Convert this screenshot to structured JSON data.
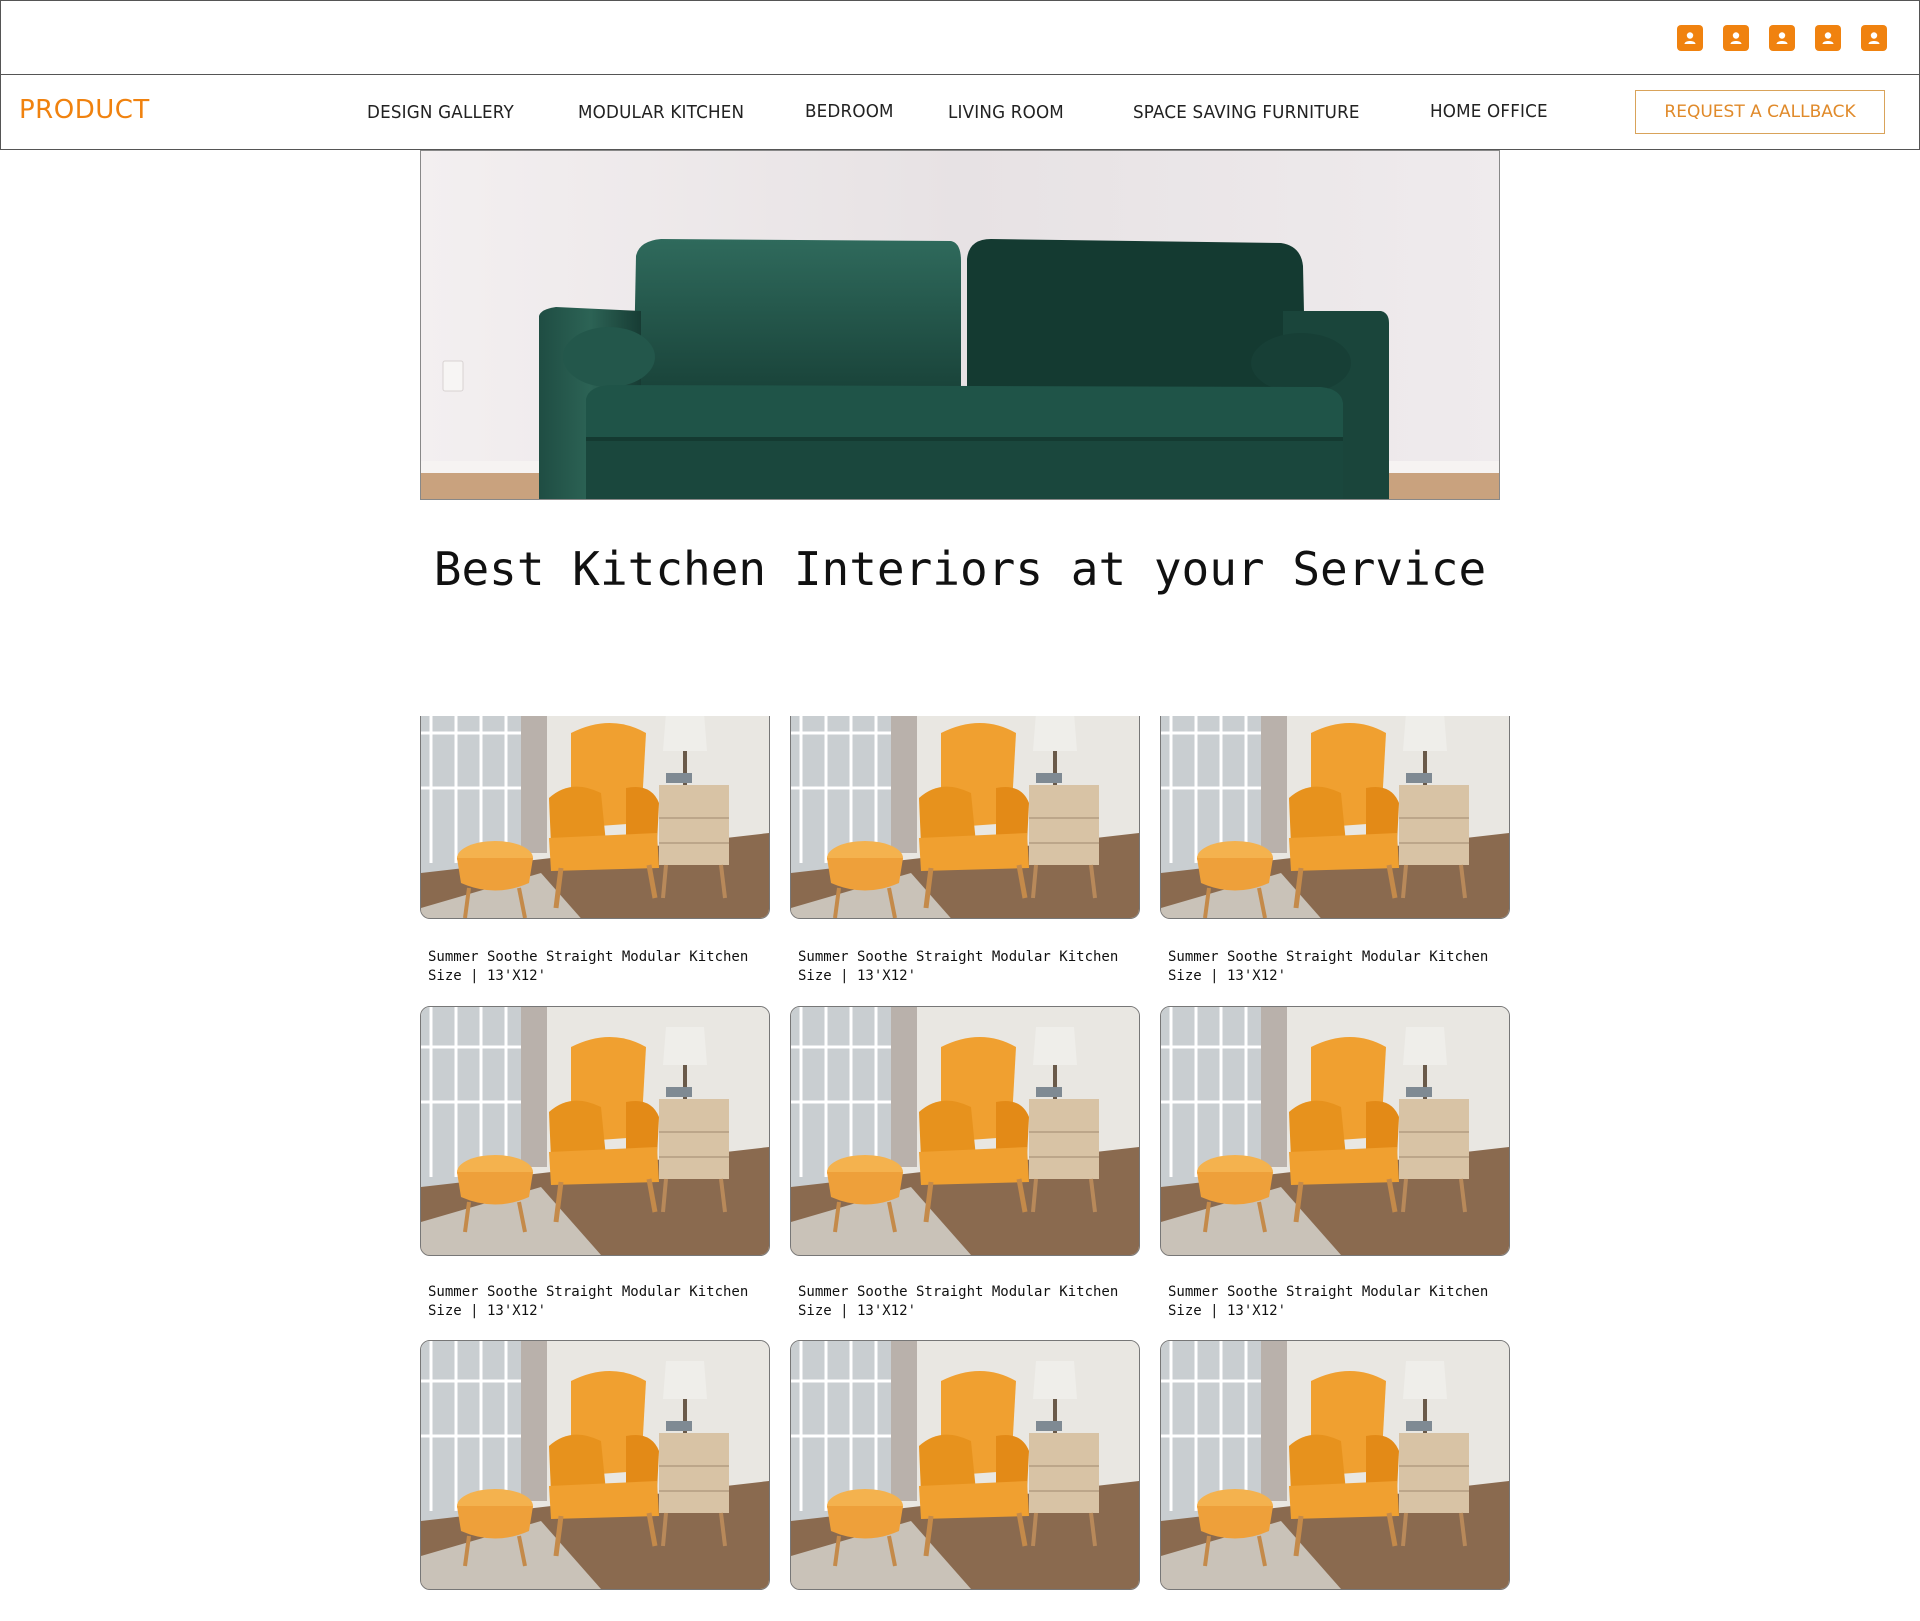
{
  "header": {
    "user_icons": [
      "user-icon",
      "user-icon",
      "user-icon",
      "user-icon",
      "user-icon"
    ],
    "accent_color": "#f0820f"
  },
  "nav": {
    "brand": "PRODUCT",
    "items": [
      "DESIGN GALLERY",
      "MODULAR KITCHEN",
      "BEDROOM",
      "LIVING ROOM",
      "SPACE SAVING FURNITURE",
      "HOME OFFICE"
    ],
    "cta": "REQUEST A CALLBACK"
  },
  "hero": {
    "image": "green-sofa-photo",
    "headline": "Best Kitchen Interiors at your Service"
  },
  "products": [
    {
      "image": "armchair-photo",
      "title": "Summer Soothe Straight Modular Kitchen",
      "size": "Size | 13'X12'"
    },
    {
      "image": "armchair-photo",
      "title": "Summer Soothe Straight Modular Kitchen",
      "size": "Size | 13'X12'"
    },
    {
      "image": "armchair-photo",
      "title": "Summer Soothe Straight Modular Kitchen",
      "size": "Size | 13'X12'"
    },
    {
      "image": "armchair-photo",
      "title": "Summer Soothe Straight Modular Kitchen",
      "size": "Size | 13'X12'"
    },
    {
      "image": "armchair-photo",
      "title": "Summer Soothe Straight Modular Kitchen",
      "size": "Size | 13'X12'"
    },
    {
      "image": "armchair-photo",
      "title": "Summer Soothe Straight Modular Kitchen",
      "size": "Size | 13'X12'"
    },
    {
      "image": "armchair-photo",
      "title": "",
      "size": ""
    },
    {
      "image": "armchair-photo",
      "title": "",
      "size": ""
    },
    {
      "image": "armchair-photo",
      "title": "",
      "size": ""
    }
  ]
}
